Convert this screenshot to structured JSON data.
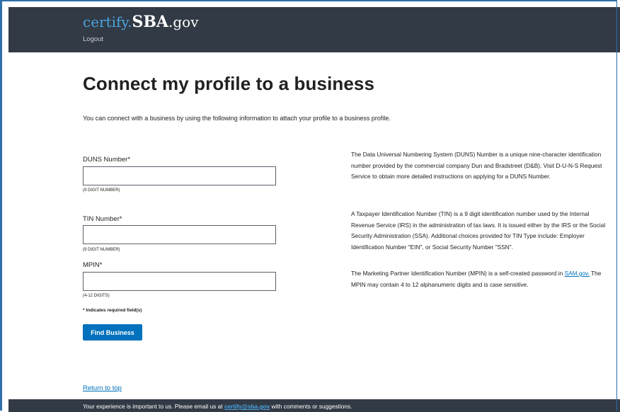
{
  "header": {
    "logo_prefix": "certify.",
    "logo_main": "SBA",
    "logo_suffix": ".gov",
    "logout_label": "Logout"
  },
  "page": {
    "title": "Connect my profile to a business",
    "intro": "You can connect with a business by using the following information to attach your profile to a business profile."
  },
  "form": {
    "duns_label": "DUNS Number*",
    "duns_value": "",
    "duns_hint": "(9 DIGIT NUMBER)",
    "tin_label": "TIN Number*",
    "tin_value": "",
    "tin_hint": "(9 DIGIT NUMBER)",
    "mpin_label": "MPIN*",
    "mpin_value": "",
    "mpin_hint": "(4-12 DIGITS)",
    "required_note": "* Indicates required field(s)",
    "submit_label": "Find Business"
  },
  "info": {
    "duns": "The Data Universal Numbering System (DUNS) Number is a unique nine-character identification number provided by the commercial company Dun and Bradstreet (D&B). Visit D-U-N-S Request Service to obtain more detailed instructions on applying for a DUNS Number.",
    "tin": "A Taxpayer Identification Number (TIN) is a 9 digit identification number used by the Internal Revenue Service (IRS) in the administration of tax laws. It is issued either by the IRS or the Social Security Administration (SSA). Additional choices provided for TIN Type include: Employer Identification Number \"EIN\", or Social Security Number \"SSN\".",
    "mpin_before": "The Marketing Partner Identification Number (MPIN) is a self-created password in ",
    "mpin_link": "SAM.gov.",
    "mpin_after": " The MPIN may contain 4 to 12 alphanumeric digits and is case sensitive."
  },
  "return_top_label": "Return to top",
  "footer": {
    "text_before": "Your experience is important to us. Please email us at ",
    "email_link": "certify@sba.gov",
    "text_after": " with comments or suggestions."
  },
  "colors": {
    "header_bg": "#323a45",
    "primary": "#0071bc",
    "logo_accent": "#4aa3df",
    "frame_border": "#2e6ea9"
  }
}
